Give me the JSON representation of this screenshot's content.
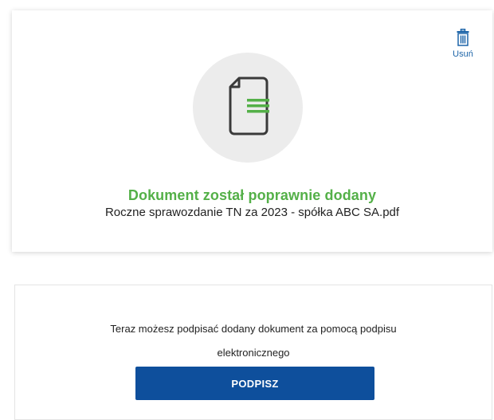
{
  "upload": {
    "delete_label": "Usuń",
    "delete_icon": "trash-icon",
    "document_icon": "document-icon",
    "status_title": "Dokument został poprawnie dodany",
    "file_name": "Roczne sprawozdanie TN za 2023 - spółka ABC SA.pdf"
  },
  "sign": {
    "info_line1": "Teraz możesz podpisać dodany dokument za pomocą podpisu",
    "info_line2": "elektronicznego",
    "button_label": "PODPISZ"
  },
  "colors": {
    "accent_blue": "#0e4f9c",
    "link_blue": "#1c64a8",
    "success_green": "#54b048",
    "circle_gray": "#ececec"
  }
}
